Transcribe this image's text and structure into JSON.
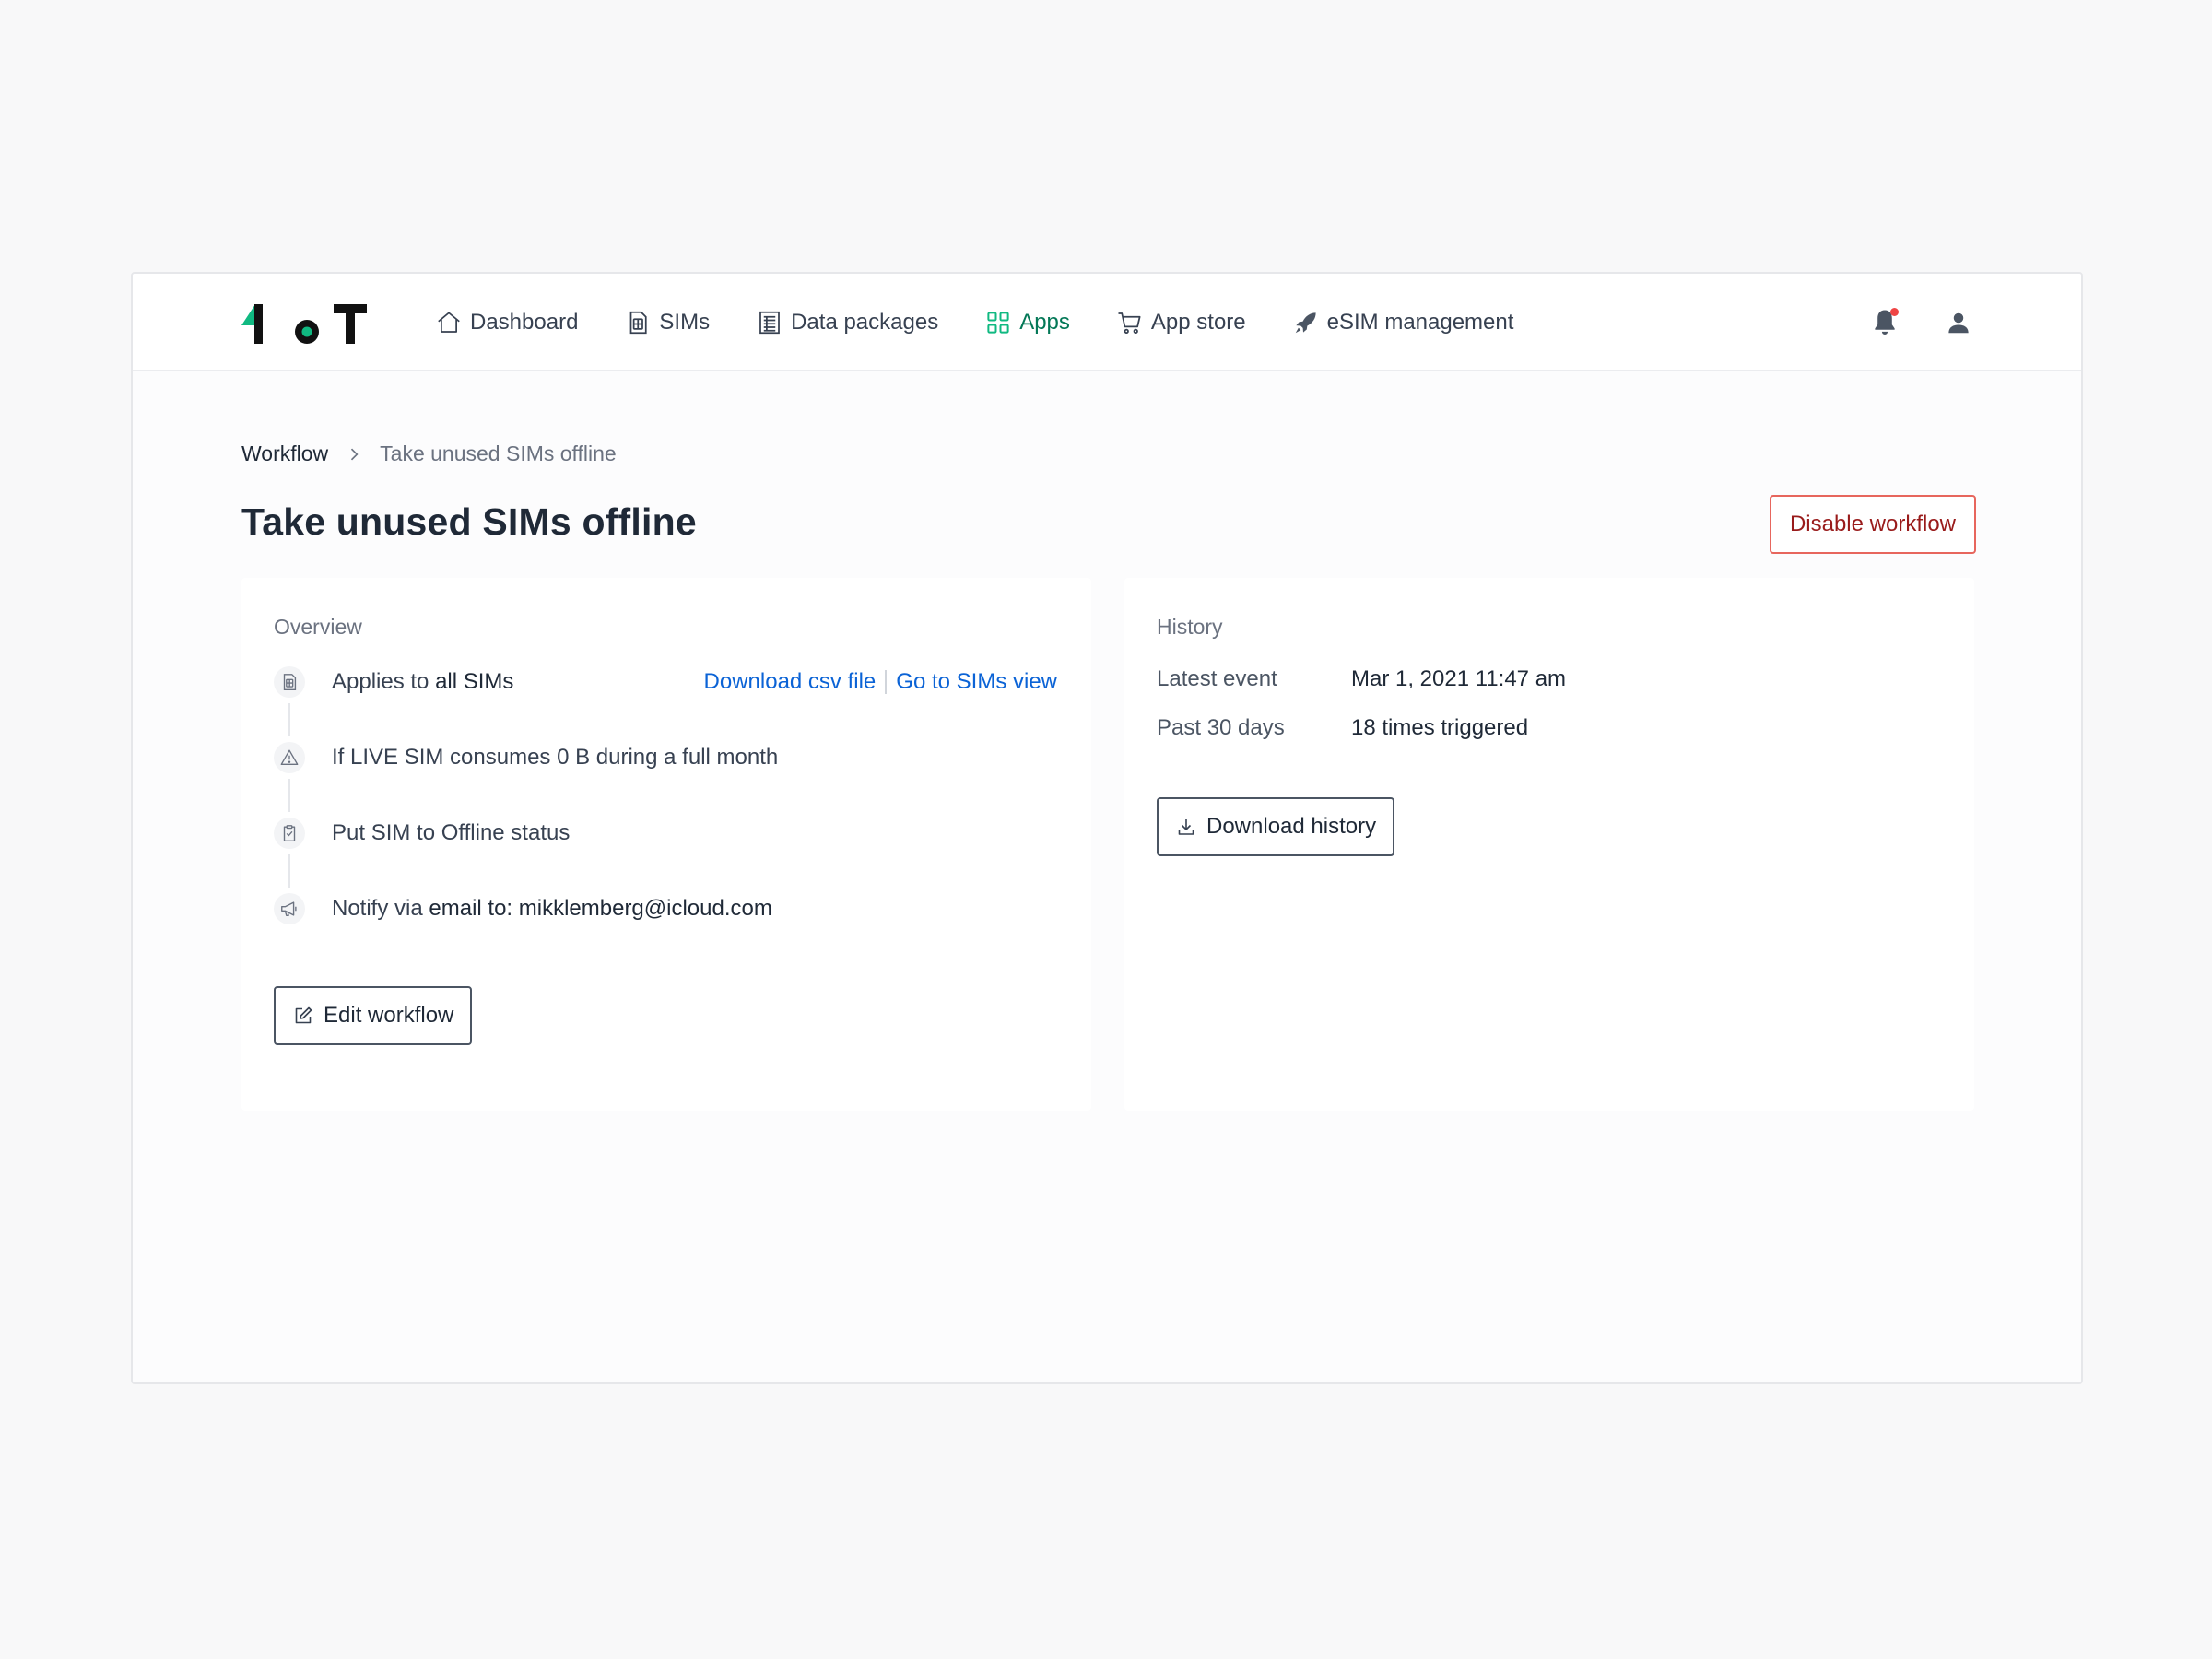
{
  "nav": {
    "items": [
      {
        "label": "Dashboard",
        "icon": "home-icon"
      },
      {
        "label": "SIMs",
        "icon": "sim-card-icon"
      },
      {
        "label": "Data packages",
        "icon": "data-package-icon"
      },
      {
        "label": "Apps",
        "icon": "apps-grid-icon",
        "active": true
      },
      {
        "label": "App store",
        "icon": "cart-icon"
      },
      {
        "label": "eSIM management",
        "icon": "rocket-icon"
      }
    ]
  },
  "colors": {
    "accent": "#047857",
    "logo_green": "#10b981",
    "danger": "#991b1b",
    "link": "#0b63d6"
  },
  "breadcrumb": {
    "parent": "Workflow",
    "current": "Take unused SIMs offline"
  },
  "page": {
    "title": "Take unused SIMs offline",
    "disable_label": "Disable workflow"
  },
  "overview": {
    "title": "Overview",
    "steps": [
      {
        "icon": "sim-card-icon",
        "prefix": "Applies to",
        "value": "all SIMs"
      },
      {
        "icon": "warning-icon",
        "text": "If LIVE SIM consumes 0 B during a full month"
      },
      {
        "icon": "clipboard-check-icon",
        "text": "Put SIM to Offline status"
      },
      {
        "icon": "megaphone-icon",
        "prefix": "Notify via",
        "value": "email to: mikklemberg@icloud.com"
      }
    ],
    "link_csv": "Download csv file",
    "link_sims": "Go to SIMs view",
    "edit_label": "Edit workflow"
  },
  "history": {
    "title": "History",
    "rows": [
      {
        "label": "Latest event",
        "value": "Mar 1, 2021 11:47 am"
      },
      {
        "label": "Past 30 days",
        "value": "18 times triggered"
      }
    ],
    "download_label": "Download history"
  }
}
